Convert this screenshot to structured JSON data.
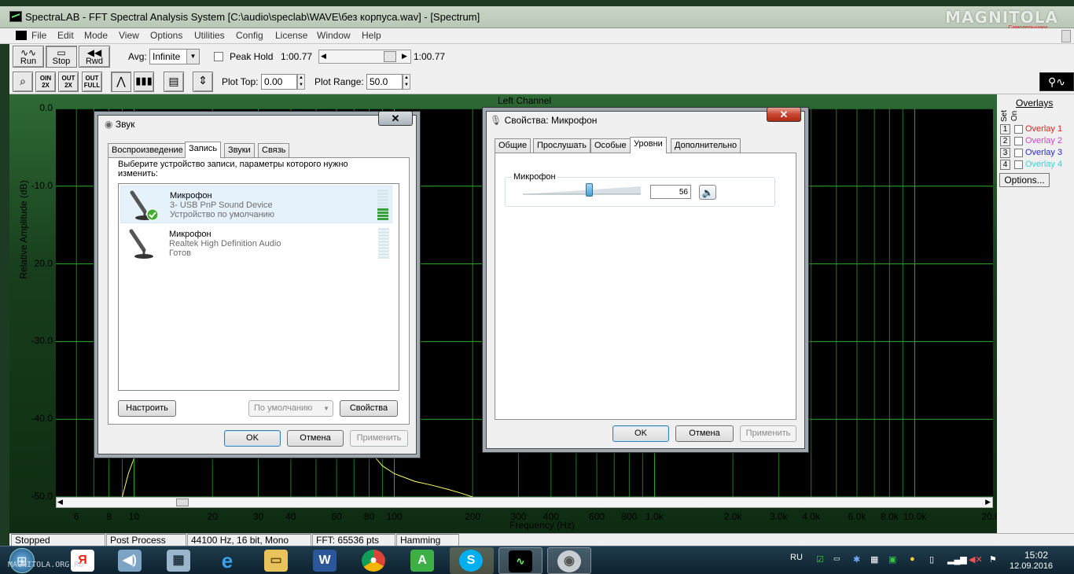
{
  "window": {
    "title": "SpectraLAB - FFT Spectral Analysis System [C:\\audio\\speclab\\WAVE\\без корпуса.wav] - [Spectrum]",
    "logo": "MAGNITOLA",
    "logo_sub": "Самодельщики"
  },
  "menu": [
    "File",
    "Edit",
    "Mode",
    "View",
    "Options",
    "Utilities",
    "Config",
    "License",
    "Window",
    "Help"
  ],
  "toolbar1": {
    "run_label": "Run",
    "stop_label": "Stop",
    "rwd_label": "Rwd",
    "avg_label": "Avg:",
    "avg_value": "Infinite",
    "peak_hold_label": "Peak Hold",
    "time_start": "1:00.77",
    "time_end": "1:00.77"
  },
  "toolbar2": {
    "zoom_in_label": "OIN\n2X",
    "zoom_out_label": "OUT\n2X",
    "zoom_full_label": "OUT\nFULL",
    "plot_top_label": "Plot Top:",
    "plot_top_value": "0.00",
    "plot_range_label": "Plot Range:",
    "plot_range_value": "50.0"
  },
  "chart_data": {
    "type": "line",
    "title": "Left Channel",
    "xlabel": "Frequency (Hz)",
    "ylabel": "Relative Amplitude (dB)",
    "x_scale": "log",
    "xlim": [
      5,
      20000
    ],
    "ylim": [
      -50,
      0
    ],
    "y_ticks": [
      "0.0",
      "-10.0",
      "20.0",
      "-30.0",
      "-40.0",
      "-50.0"
    ],
    "x_ticks": [
      "6",
      "8",
      "10",
      "20",
      "30",
      "40",
      "60",
      "80",
      "100",
      "200",
      "300",
      "400",
      "600",
      "800",
      "1.0k",
      "2.0k",
      "3.0k",
      "4.0k",
      "6.0k",
      "8.0k",
      "10.0k",
      "20.0k"
    ],
    "x_tick_values": [
      6,
      8,
      10,
      20,
      30,
      40,
      60,
      80,
      100,
      200,
      300,
      400,
      600,
      800,
      1000,
      2000,
      3000,
      4000,
      6000,
      8000,
      10000,
      20000
    ],
    "grid": true,
    "series": [
      {
        "color": "#ffff66",
        "x": [
          9,
          9.5,
          10,
          80,
          90,
          100,
          120,
          140,
          160,
          180,
          200
        ],
        "y": [
          -50,
          -47,
          -45,
          -44,
          -46,
          -47,
          -48,
          -48.5,
          -49,
          -49.5,
          -50
        ]
      }
    ]
  },
  "overlays": {
    "title": "Overlays",
    "set_header": "Set",
    "on_header": "On",
    "items": [
      {
        "num": "1",
        "name": "Overlay 1",
        "color": "#e0201f"
      },
      {
        "num": "2",
        "name": "Overlay 2",
        "color": "#d23cd2"
      },
      {
        "num": "3",
        "name": "Overlay 3",
        "color": "#2a2ad2"
      },
      {
        "num": "4",
        "name": "Overlay 4",
        "color": "#35d6d6"
      }
    ],
    "options_label": "Options..."
  },
  "status": [
    "Stopped",
    "Post Process",
    "44100 Hz, 16 bit, Mono",
    "FFT: 65536 pts",
    "Hamming"
  ],
  "sound_dialog": {
    "title": "Звук",
    "tabs": [
      "Воспроизведение",
      "Запись",
      "Звуки",
      "Связь"
    ],
    "prompt": "Выберите устройство записи, параметры которого нужно изменить:",
    "devices": [
      {
        "name": "Микрофон",
        "desc": "3- USB PnP Sound Device",
        "state": "Устройство по умолчанию"
      },
      {
        "name": "Микрофон",
        "desc": "Realtek High Definition Audio",
        "state": "Готов"
      }
    ],
    "configure": "Настроить",
    "set_default": "По умолчанию",
    "properties": "Свойства",
    "ok": "OK",
    "cancel": "Отмена",
    "apply": "Применить"
  },
  "mic_dialog": {
    "title": "Свойства: Микрофон",
    "tabs": [
      "Общие",
      "Прослушать",
      "Особые",
      "Уровни",
      "Дополнительно"
    ],
    "group_label": "Микрофон",
    "level_value": "56",
    "level_fraction": 0.56,
    "ok": "OK",
    "cancel": "Отмена",
    "apply": "Применить"
  },
  "taskbar": {
    "lang": "RU",
    "time": "15:02",
    "date": "12.09.2016",
    "watermark": "MAGNITOLA.ORG.RU"
  }
}
